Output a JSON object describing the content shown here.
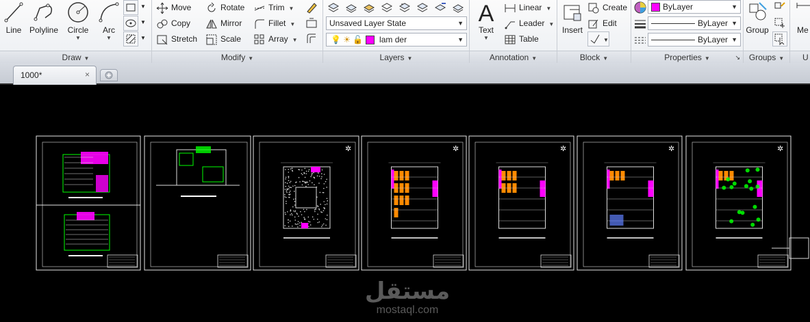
{
  "ribbon": {
    "draw": {
      "title": "Draw",
      "line": "Line",
      "polyline": "Polyline",
      "circle": "Circle",
      "arc": "Arc"
    },
    "modify": {
      "title": "Modify",
      "move": "Move",
      "rotate": "Rotate",
      "trim": "Trim",
      "copy": "Copy",
      "mirror": "Mirror",
      "fillet": "Fillet",
      "stretch": "Stretch",
      "scale": "Scale",
      "array": "Array"
    },
    "layers": {
      "title": "Layers",
      "layer_state": "Unsaved Layer State",
      "current_layer": "lam der",
      "layer_color": "#ff00ff"
    },
    "annotation": {
      "title": "Annotation",
      "text": "Text",
      "linear": "Linear",
      "leader": "Leader",
      "table": "Table"
    },
    "block": {
      "title": "Block",
      "insert": "Insert",
      "create": "Create",
      "edit": "Edit"
    },
    "properties": {
      "title": "Properties",
      "color": "ByLayer",
      "linetype": "ByLayer",
      "lineweight": "ByLayer",
      "color_swatch": "#ff00ff"
    },
    "groups": {
      "title": "Groups",
      "group": "Group"
    },
    "cut_label": "Me",
    "cut_title": "U"
  },
  "tabs": {
    "active": "1000*",
    "close_glyph": "×"
  },
  "watermark": {
    "arabic": "مستقل",
    "latin": "mostaql.com"
  },
  "colors": {
    "canvas": "#000000",
    "accent_magenta": "#ff00ff",
    "plan_orange": "#ff8a00",
    "plan_green": "#00ff00"
  }
}
